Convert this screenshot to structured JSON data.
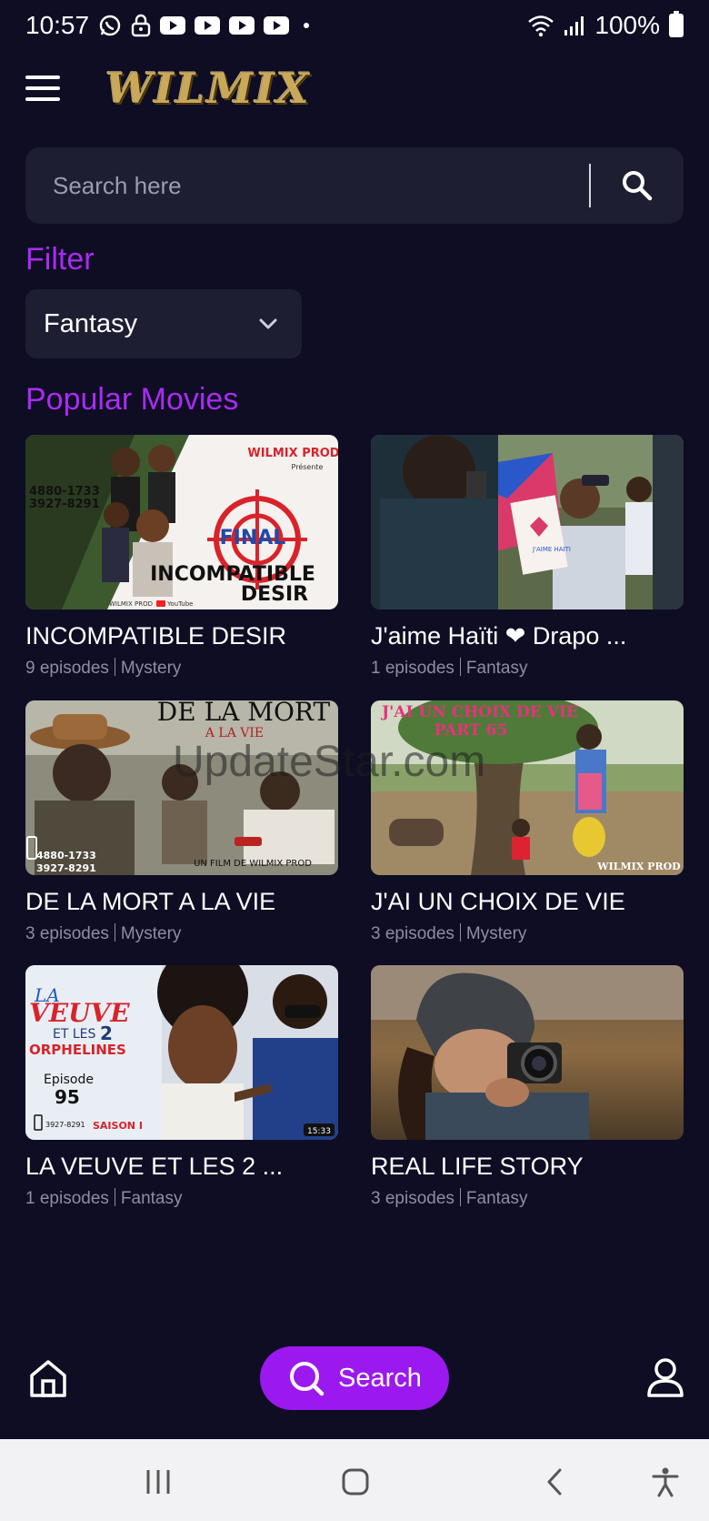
{
  "status_bar": {
    "time": "10:57",
    "battery": "100%",
    "icons": [
      "whatsapp-icon",
      "lock-icon",
      "youtube-icon",
      "youtube-icon",
      "youtube-icon",
      "youtube-icon",
      "dot-icon",
      "wifi-icon",
      "signal-icon",
      "battery-icon"
    ]
  },
  "header": {
    "menu_icon": "hamburger-menu-icon",
    "logo_text": "WILMIX"
  },
  "search": {
    "placeholder": "Search here",
    "value": "",
    "icon": "search-icon"
  },
  "filter": {
    "title": "Filter",
    "selected": "Fantasy",
    "icon": "chevron-down-icon"
  },
  "popular": {
    "title": "Popular Movies",
    "movies": [
      {
        "title": "INCOMPATIBLE DESIR",
        "episodes": "9 episodes",
        "genre": "Mystery",
        "thumb_text": {
          "brand": "WILMIX PROD",
          "presente": "Présente",
          "phone1": "4880-1733",
          "phone2": "3927-8291",
          "final": "FINAL",
          "line1": "INCOMPATIBLE",
          "line2": "DESIR",
          "footer": "WILMIX PROD",
          "youtube": "YouTube"
        }
      },
      {
        "title": "J'aime Haïti ❤ Drapo ...",
        "episodes": "1 episodes",
        "genre": "Fantasy",
        "thumb_text": {
          "sign": "J'AIME HAITI"
        }
      },
      {
        "title": "DE LA MORT A LA VIE",
        "episodes": "3 episodes",
        "genre": "Mystery",
        "thumb_text": {
          "line1": "DE LA MORT",
          "line2": "A LA VIE",
          "credit": "UN FILM DE WILMIX PROD",
          "phone1": "4880-1733",
          "phone2": "3927-8291",
          "watermark": "UpdateStar.com"
        }
      },
      {
        "title": "J'AI UN CHOIX DE VIE",
        "episodes": "3 episodes",
        "genre": "Mystery",
        "thumb_text": {
          "line1": "J'AI UN CHOIX DE VIE",
          "line2": "PART 65",
          "brand": "WILMIX PROD"
        }
      },
      {
        "title": "LA VEUVE ET LES 2 ...",
        "episodes": "1 episodes",
        "genre": "Fantasy",
        "thumb_text": {
          "la": "LA",
          "veuve": "VEUVE",
          "et_les": "ET LES",
          "two": "2",
          "orphelines": "ORPHELINES",
          "episode": "Episode",
          "ep_num": "95",
          "phone": "3927-8291",
          "saison": "SAISON I",
          "duration": "15:33"
        }
      },
      {
        "title": "REAL LIFE STORY",
        "episodes": "3 episodes",
        "genre": "Fantasy",
        "thumb_text": {}
      }
    ]
  },
  "bottom_nav": {
    "home_icon": "home-icon",
    "search_label": "Search",
    "search_icon": "search-icon",
    "profile_icon": "user-icon"
  },
  "system_nav": {
    "icons": [
      "recent-apps-icon",
      "home-button-icon",
      "back-icon",
      "accessibility-icon"
    ]
  },
  "colors": {
    "background": "#0e0d24",
    "surface": "#1e1e33",
    "accent": "#a92bf2",
    "search_button": "#9b19ee",
    "muted_text": "#8d8da3"
  }
}
